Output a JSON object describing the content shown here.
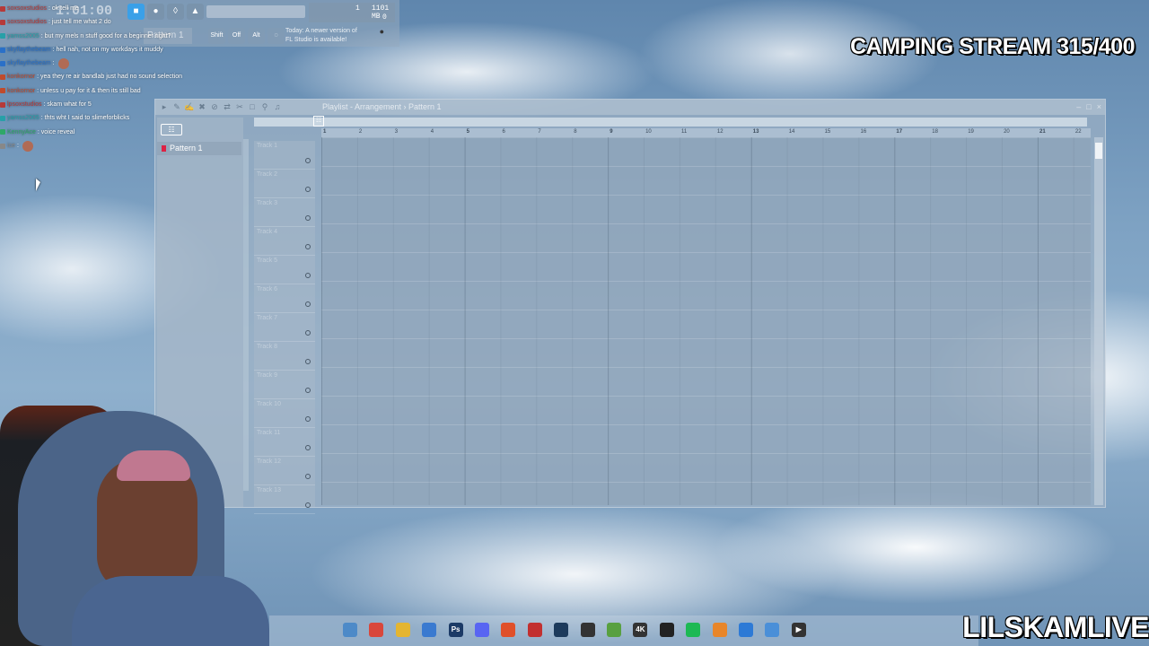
{
  "fl_toolbar": {
    "time": "1:01:00",
    "readout_top": "1",
    "readout_mem": "1101 MB",
    "readout_bottom": "0",
    "pattern_selector": "Pattern 1",
    "buttons": [
      "Shift",
      "Off",
      "Alt"
    ],
    "update_note_line1": "Today:  A newer version of",
    "update_note_line2": "FL Studio is available!"
  },
  "chat": [
    {
      "user": "soxsoxstudios",
      "text": ": ok tell me",
      "color": "#b63a3a"
    },
    {
      "user": "soxsoxstudios",
      "text": ": just tell me what 2 do",
      "color": "#b63a3a"
    },
    {
      "user": "yamss2005",
      "text": ": but my mels n stuff good for a beginner right?",
      "color": "#27a0a8"
    },
    {
      "user": "skyflaythebeam",
      "text": ": hell nah, not on my workdays it muddy",
      "color": "#2a70c8"
    },
    {
      "user": "skyflaythebeam",
      "text": ":",
      "color": "#2a70c8",
      "emote": true
    },
    {
      "user": "konkornor",
      "text": ": yea they re air bandlab just had no sound selection",
      "color": "#c04b2d"
    },
    {
      "user": "konkornor",
      "text": ": unless u pay for it & then its still bad",
      "color": "#c04b2d"
    },
    {
      "user": "lpsoxstudios",
      "text": ": skam what for 5",
      "color": "#b63a3a"
    },
    {
      "user": "yamss2005",
      "text": ": thts wht I said to slimeforblicks",
      "color": "#27a0a8"
    },
    {
      "user": "KennyAce",
      "text": ": voice reveal",
      "color": "#2fa868"
    },
    {
      "user": "ice",
      "text": ":",
      "color": "#888",
      "emote": true
    }
  ],
  "stream_title": "CAMPING STREAM 315/400",
  "channel_name": "LILSKAMLIVE",
  "playlist": {
    "title": "Playlist - Arrangement › Pattern 1",
    "picker_item": "Pattern 1",
    "tracks": [
      "Track 1",
      "Track 2",
      "Track 3",
      "Track 4",
      "Track 5",
      "Track 6",
      "Track 7",
      "Track 8",
      "Track 9",
      "Track 10",
      "Track 11",
      "Track 12",
      "Track 13"
    ],
    "ruler": [
      "1",
      "2",
      "3",
      "4",
      "5",
      "6",
      "7",
      "8",
      "9",
      "10",
      "11",
      "12",
      "13",
      "14",
      "15",
      "16",
      "17",
      "18",
      "19",
      "20",
      "21",
      "22"
    ]
  },
  "taskbar_icons": [
    {
      "name": "explorer-icon",
      "glyph": "",
      "color": "#4d8ac8"
    },
    {
      "name": "chrome-icon",
      "glyph": "",
      "color": "#d9473b"
    },
    {
      "name": "folder-icon",
      "glyph": "",
      "color": "#e4b530"
    },
    {
      "name": "store-icon",
      "glyph": "",
      "color": "#3a7ad0"
    },
    {
      "name": "photoshop-icon",
      "glyph": "Ps",
      "color": "#1b3a66"
    },
    {
      "name": "discord-icon",
      "glyph": "",
      "color": "#5865f2"
    },
    {
      "name": "brave-icon",
      "glyph": "",
      "color": "#e0502a"
    },
    {
      "name": "app-red-icon",
      "glyph": "",
      "color": "#c23030"
    },
    {
      "name": "steam-icon",
      "glyph": "",
      "color": "#1d3b5c"
    },
    {
      "name": "app-dark-icon",
      "glyph": "",
      "color": "#333"
    },
    {
      "name": "app-green-icon",
      "glyph": "",
      "color": "#58a040"
    },
    {
      "name": "4k-icon",
      "glyph": "4K",
      "color": "#333"
    },
    {
      "name": "app-dark2-icon",
      "glyph": "",
      "color": "#222"
    },
    {
      "name": "spotify-icon",
      "glyph": "",
      "color": "#1db954"
    },
    {
      "name": "fl-studio-icon",
      "glyph": "",
      "color": "#e8862a"
    },
    {
      "name": "app-blue-icon",
      "glyph": "",
      "color": "#2d7ad6"
    },
    {
      "name": "notepad-icon",
      "glyph": "",
      "color": "#4a8fd8"
    },
    {
      "name": "media-player-icon",
      "glyph": "▶",
      "color": "#333"
    }
  ]
}
